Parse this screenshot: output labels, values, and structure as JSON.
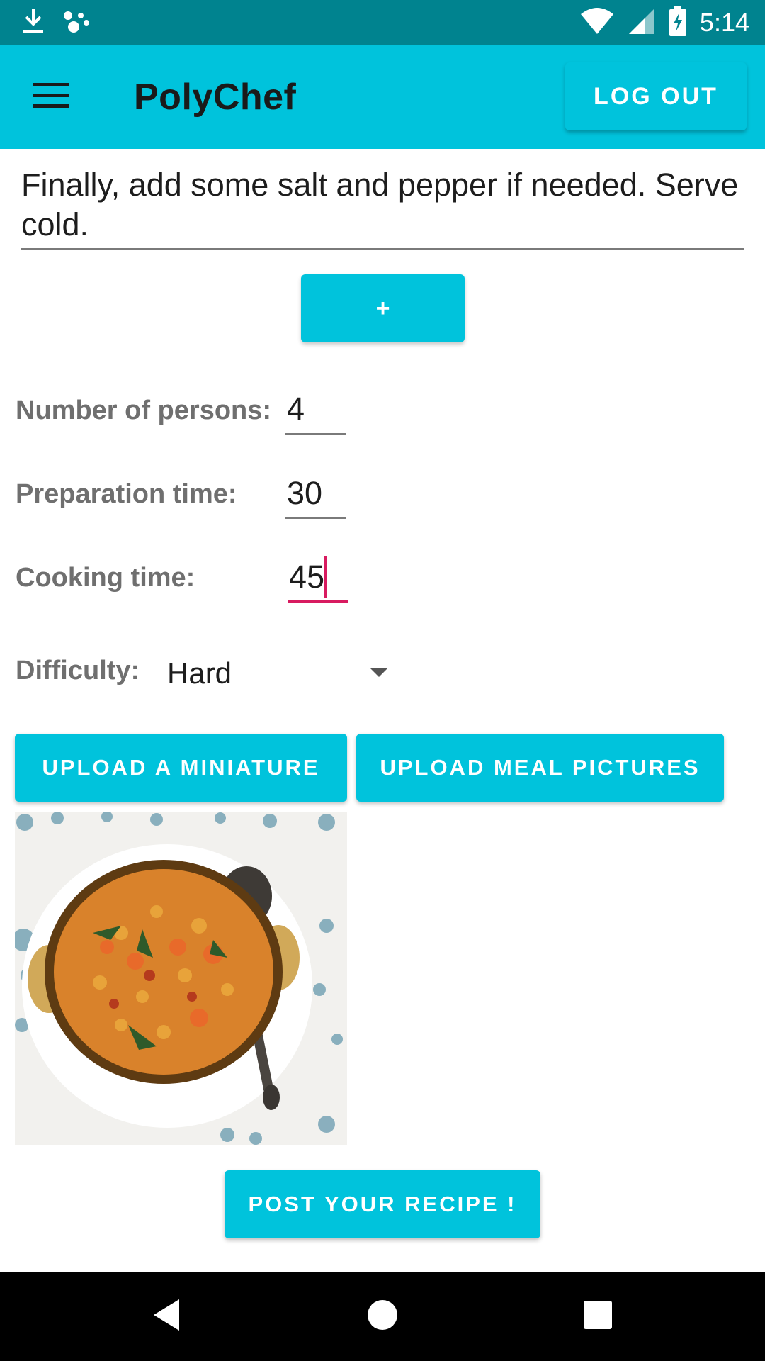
{
  "status_bar": {
    "time": "5:14",
    "left_icons": [
      "download-icon",
      "assistant-dots-icon"
    ],
    "right_icons": [
      "wifi-icon",
      "cell-signal-icon",
      "battery-charging-icon"
    ]
  },
  "app_bar": {
    "title": "PolyChef",
    "logout_label": "LOG OUT",
    "menu_icon": "hamburger-menu-icon"
  },
  "recipe_form": {
    "step_text": "Finally, add some salt and pepper if needed. Serve cold.",
    "add_step_label": "+",
    "persons_label": "Number of persons:",
    "persons_value": "4",
    "prep_label": "Preparation time:",
    "prep_value": "30",
    "cooking_label": "Cooking time:",
    "cooking_value": "45",
    "difficulty_label": "Difficulty:",
    "difficulty_value": "Hard",
    "upload_miniature_label": "UPLOAD A MINIATURE",
    "upload_pictures_label": "UPLOAD MEAL PICTURES",
    "post_label": "POST YOUR RECIPE !"
  },
  "nav_bar": {
    "icons": [
      "back-icon",
      "home-icon",
      "recents-icon"
    ]
  },
  "colors": {
    "status_bar": "#00838f",
    "app_bar": "#00c3dc",
    "accent": "#d81b60",
    "button": "#00c3dc"
  }
}
